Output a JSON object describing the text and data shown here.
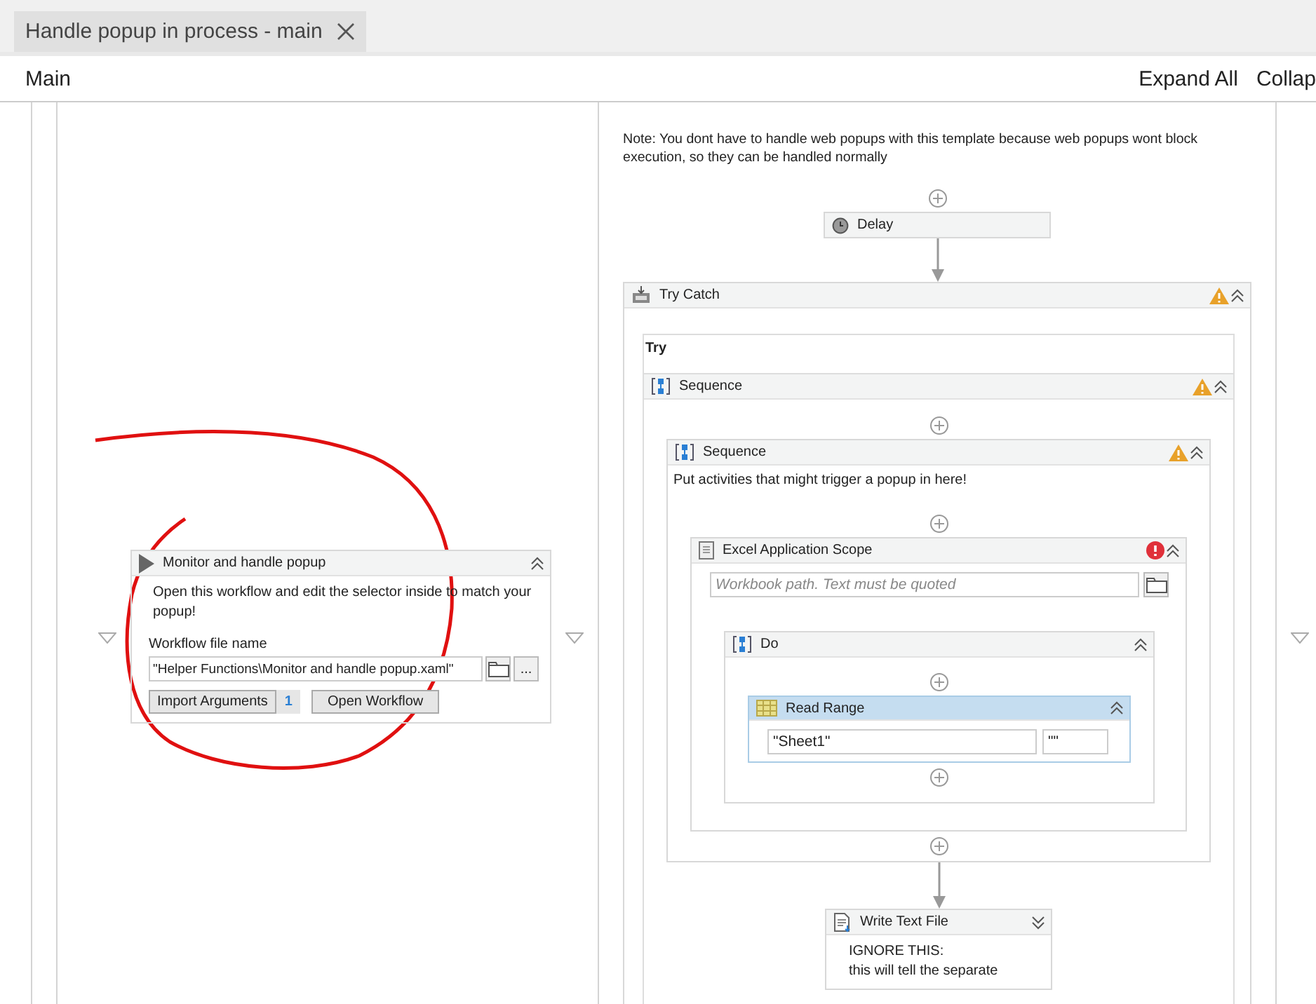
{
  "tab": {
    "title": "Handle popup in process - main",
    "selected": true
  },
  "toolbar": {
    "title": "Main",
    "actions": [
      "Expand All",
      "Collap"
    ]
  },
  "left_activity": {
    "kind": "invoke-workflow",
    "title": "Monitor and handle popup",
    "expanded": true,
    "description": "Open this workflow and edit the selector inside to match your popup!",
    "field_label": "Workflow file name",
    "file_value": "\"Helper Functions\\Monitor and handle popup.xaml\"",
    "more_button": "...",
    "import_button": "Import Arguments",
    "argument_count": "1",
    "open_button": "Open Workflow"
  },
  "note": "Note: You dont have to handle web popups with this template because web popups wont block execution, so they can be handled normally",
  "delay": {
    "kind": "delay",
    "title": "Delay"
  },
  "try_catch": {
    "kind": "try-catch",
    "title": "Try Catch",
    "warning": true,
    "expanded": true,
    "try_label": "Try",
    "sequence": {
      "kind": "sequence",
      "title": "Sequence",
      "warning": true,
      "expanded": true,
      "inner": {
        "kind": "sequence",
        "title": "Sequence",
        "warning": true,
        "expanded": true,
        "annotation": "Put activities that might trigger a popup in here!",
        "excel_scope": {
          "kind": "excel-scope",
          "title": "Excel Application Scope",
          "error": true,
          "expanded": true,
          "path_placeholder": "Workbook path. Text must be quoted",
          "do": {
            "kind": "sequence",
            "title": "Do",
            "expanded": true,
            "read_range": {
              "kind": "read-range",
              "title": "Read Range",
              "selected": true,
              "expanded": true,
              "sheet": "\"Sheet1\"",
              "range": "\"\""
            }
          }
        }
      }
    }
  },
  "write_text_file": {
    "kind": "write-text-file",
    "title": "Write Text File",
    "expanded": false,
    "lines": [
      "IGNORE THIS:",
      "this will tell the separate"
    ]
  }
}
